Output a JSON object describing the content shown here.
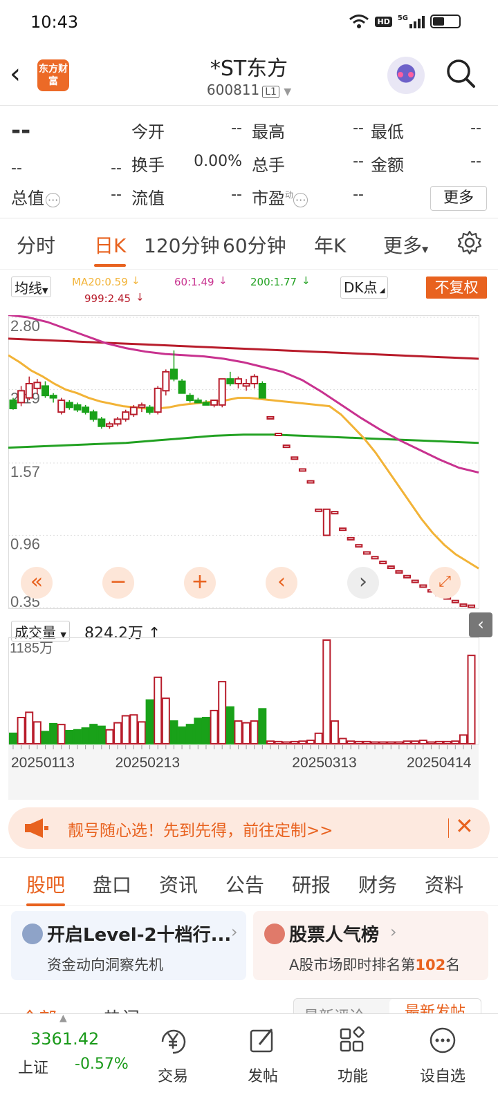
{
  "status": {
    "time": "10:43",
    "network": "5G",
    "hd": "HD"
  },
  "header": {
    "logo_text": "东方财富",
    "title": "*ST东方",
    "code": "600811",
    "level": "L1"
  },
  "quote": {
    "price": "--",
    "rows": [
      [
        {
          "label": "今开",
          "value": "--"
        },
        {
          "label": "最高",
          "value": "--"
        },
        {
          "label": "最低",
          "value": "--"
        }
      ],
      [
        {
          "label": "",
          "value": "--"
        },
        {
          "label": "换手",
          "value": "0.00%"
        },
        {
          "label": "总手",
          "value": "--"
        },
        {
          "label": "金额",
          "value": "--"
        }
      ],
      [
        {
          "label": "总值",
          "value": "--"
        },
        {
          "label": "流值",
          "value": "--"
        },
        {
          "label": "市盈",
          "value": "--"
        }
      ]
    ],
    "first_row_left": "--",
    "pe_superscript": "动",
    "more": "更多"
  },
  "ktabs": [
    "分时",
    "日K",
    "120分钟",
    "60分钟",
    "年K",
    "更多"
  ],
  "ktab_active": 1,
  "chart_controls": {
    "ma_select": "均线",
    "dk_select": "DK点",
    "fq": "不复权",
    "vol_select": "成交量",
    "vol_value": "824.2万",
    "vol_axis_max": "1185万"
  },
  "ma_legend": [
    {
      "text": "MA20:0.59",
      "color": "#f2b337"
    },
    {
      "text": "60:1.49",
      "color": "#c8328f"
    },
    {
      "text": "200:1.77",
      "color": "#22a122"
    },
    {
      "text": "999:2.45",
      "color": "#b81c2b"
    }
  ],
  "chart_data": {
    "type": "candlestick",
    "y_ticks": [
      "2.80",
      "2.19",
      "1.57",
      "0.96",
      "0.35"
    ],
    "x_ticks": [
      "20250113",
      "20250213",
      "20250313",
      "20250414"
    ],
    "ylim": [
      0.35,
      2.8
    ],
    "candles": [
      [
        2.1,
        2.12,
        2.02,
        2.03
      ],
      [
        2.08,
        2.22,
        2.05,
        2.18
      ],
      [
        2.12,
        2.3,
        2.1,
        2.24
      ],
      [
        2.2,
        2.28,
        2.15,
        2.25
      ],
      [
        2.22,
        2.26,
        2.12,
        2.14
      ],
      [
        2.14,
        2.16,
        2.08,
        2.12
      ],
      [
        2.0,
        2.12,
        1.98,
        2.1
      ],
      [
        2.08,
        2.1,
        2.02,
        2.04
      ],
      [
        2.06,
        2.08,
        2.0,
        2.02
      ],
      [
        2.04,
        2.06,
        1.98,
        2.0
      ],
      [
        2.0,
        2.02,
        1.92,
        1.94
      ],
      [
        1.94,
        1.96,
        1.86,
        1.88
      ],
      [
        1.88,
        1.92,
        1.86,
        1.9
      ],
      [
        1.9,
        1.96,
        1.88,
        1.94
      ],
      [
        1.94,
        2.02,
        1.92,
        2.0
      ],
      [
        1.98,
        2.06,
        1.96,
        2.04
      ],
      [
        2.04,
        2.08,
        2.0,
        2.06
      ],
      [
        2.04,
        2.06,
        1.98,
        2.0
      ],
      [
        2.0,
        2.22,
        1.98,
        2.2
      ],
      [
        2.18,
        2.36,
        2.14,
        2.34
      ],
      [
        2.36,
        2.52,
        2.26,
        2.28
      ],
      [
        2.26,
        2.28,
        2.16,
        2.16
      ],
      [
        2.14,
        2.16,
        2.08,
        2.1
      ],
      [
        2.1,
        2.12,
        2.08,
        2.08
      ],
      [
        2.08,
        2.1,
        2.06,
        2.06
      ],
      [
        2.06,
        2.1,
        2.04,
        2.1
      ],
      [
        2.06,
        2.28,
        2.04,
        2.28
      ],
      [
        2.28,
        2.34,
        2.22,
        2.24
      ],
      [
        2.24,
        2.3,
        2.2,
        2.28
      ],
      [
        2.22,
        2.28,
        2.18,
        2.24
      ],
      [
        2.24,
        2.32,
        2.2,
        2.3
      ],
      [
        2.24,
        2.26,
        2.12,
        2.12
      ],
      [
        1.96,
        1.96,
        1.96,
        1.96
      ],
      [
        1.82,
        1.82,
        1.82,
        1.82
      ],
      [
        1.72,
        1.72,
        1.72,
        1.72
      ],
      [
        1.62,
        1.62,
        1.62,
        1.62
      ],
      [
        1.52,
        1.52,
        1.52,
        1.52
      ],
      [
        1.42,
        1.42,
        1.42,
        1.42
      ],
      [
        1.18,
        1.18,
        1.18,
        1.18
      ],
      [
        0.96,
        1.18,
        0.96,
        1.18
      ],
      [
        1.16,
        1.16,
        1.16,
        1.16
      ],
      [
        1.02,
        1.02,
        1.02,
        1.02
      ],
      [
        0.94,
        0.94,
        0.94,
        0.94
      ],
      [
        0.88,
        0.88,
        0.88,
        0.88
      ],
      [
        0.82,
        0.82,
        0.82,
        0.82
      ],
      [
        0.78,
        0.78,
        0.78,
        0.78
      ],
      [
        0.74,
        0.74,
        0.74,
        0.74
      ],
      [
        0.7,
        0.7,
        0.7,
        0.7
      ],
      [
        0.66,
        0.66,
        0.66,
        0.66
      ],
      [
        0.62,
        0.62,
        0.62,
        0.62
      ],
      [
        0.58,
        0.58,
        0.58,
        0.58
      ],
      [
        0.54,
        0.54,
        0.54,
        0.54
      ],
      [
        0.5,
        0.5,
        0.5,
        0.5
      ],
      [
        0.47,
        0.47,
        0.47,
        0.47
      ],
      [
        0.44,
        0.44,
        0.44,
        0.44
      ],
      [
        0.41,
        0.41,
        0.41,
        0.41
      ],
      [
        0.38,
        0.38,
        0.38,
        0.38
      ],
      [
        0.36,
        0.37,
        0.35,
        0.37
      ]
    ],
    "volumes": [
      120,
      300,
      360,
      250,
      140,
      230,
      220,
      150,
      160,
      180,
      220,
      200,
      160,
      240,
      320,
      330,
      250,
      500,
      760,
      520,
      260,
      190,
      220,
      290,
      300,
      380,
      710,
      420,
      260,
      240,
      260,
      400,
      30,
      25,
      20,
      25,
      30,
      40,
      120,
      1185,
      260,
      60,
      30,
      25,
      25,
      20,
      20,
      20,
      20,
      30,
      30,
      40,
      20,
      25,
      25,
      30,
      100,
      1010
    ],
    "ma20": [
      2.48,
      2.42,
      2.35,
      2.3,
      2.24,
      2.19,
      2.16,
      2.12,
      2.09,
      2.07,
      2.05,
      2.04,
      2.03,
      2.03,
      2.04,
      2.06,
      2.07,
      2.08,
      2.09,
      2.1,
      2.12,
      2.12,
      2.11,
      2.1,
      2.09,
      2.08,
      2.07,
      2.06,
      2.05,
      1.98,
      1.88,
      1.78,
      1.66,
      1.52,
      1.38,
      1.24,
      1.1,
      0.98,
      0.88,
      0.8,
      0.74,
      0.68
    ],
    "ma60": [
      2.82,
      2.8,
      2.76,
      2.7,
      2.64,
      2.58,
      2.54,
      2.51,
      2.49,
      2.48,
      2.47,
      2.45,
      2.42,
      2.38,
      2.34,
      2.27,
      2.17,
      2.06,
      1.95,
      1.85,
      1.76,
      1.68,
      1.6,
      1.53,
      1.49
    ],
    "ma200": [
      1.7,
      1.71,
      1.72,
      1.73,
      1.74,
      1.76,
      1.78,
      1.8,
      1.81,
      1.81,
      1.8,
      1.79,
      1.78,
      1.77,
      1.76,
      1.75,
      1.74
    ],
    "ma999": [
      2.62,
      2.61,
      2.6,
      2.59,
      2.58,
      2.57,
      2.56,
      2.55,
      2.54,
      2.53,
      2.52,
      2.51,
      2.5,
      2.49,
      2.48,
      2.47,
      2.46,
      2.45
    ]
  },
  "banner": {
    "text": "靓号随心选！先到先得，前往定制>>"
  },
  "btabs": [
    "股吧",
    "盘口",
    "资讯",
    "公告",
    "研报",
    "财务",
    "资料"
  ],
  "btab_active": 0,
  "cards": [
    {
      "title": "开启Level-2十档行...",
      "sub": "资金动向洞察先机"
    },
    {
      "title": "股票人气榜",
      "sub_pre": "A股市场即时排名第",
      "rank": "102",
      "sub_post": "名"
    }
  ],
  "subtabs": {
    "a": "全部",
    "b": "热门",
    "c": "最新评论",
    "d": "最新发帖"
  },
  "bottom": {
    "index_value": "3361.42",
    "index_name": "上证",
    "index_change": "-0.57%",
    "items": [
      "交易",
      "发帖",
      "功能",
      "设自选"
    ]
  }
}
